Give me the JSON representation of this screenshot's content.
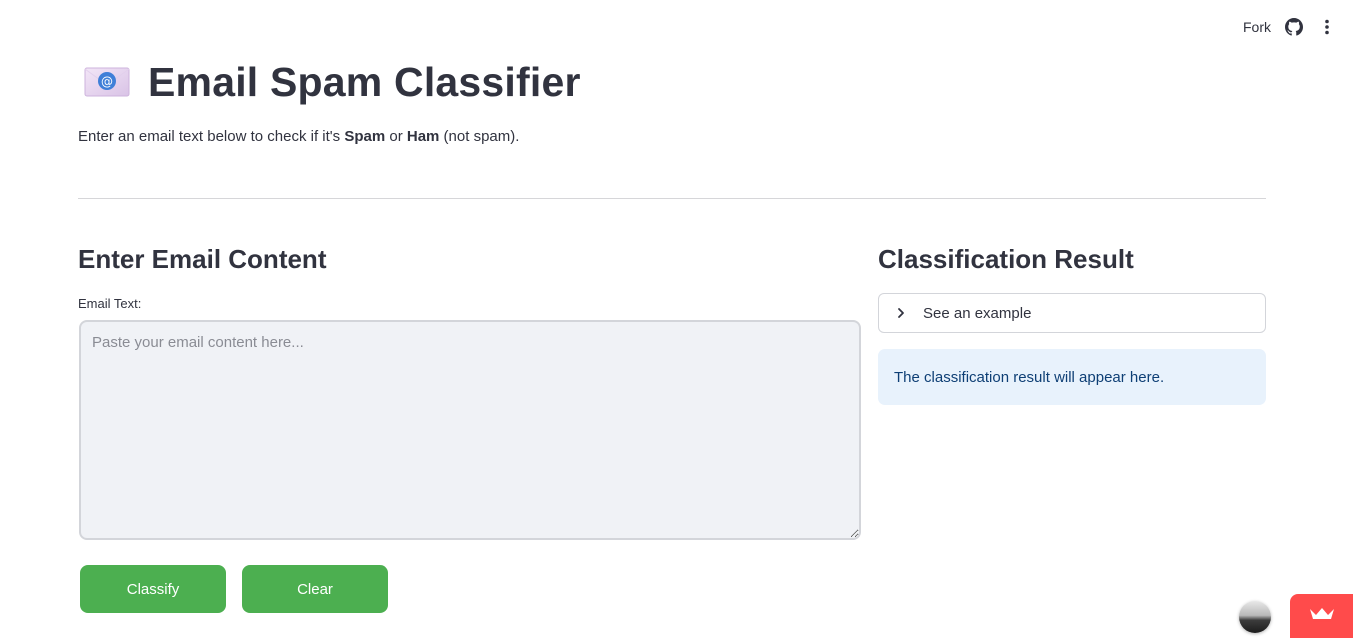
{
  "toolbar": {
    "fork_label": "Fork"
  },
  "header": {
    "title": "Email Spam Classifier",
    "icon": "envelope-email-icon"
  },
  "subtitle": {
    "prefix": "Enter an email text below to check if it's ",
    "spam_word": "Spam",
    "middle": " or ",
    "ham_word": "Ham",
    "suffix": " (not spam)."
  },
  "input_section": {
    "heading": "Enter Email Content",
    "field_label": "Email Text:",
    "value": "",
    "placeholder": "Paste your email content here...",
    "classify_label": "Classify",
    "clear_label": "Clear"
  },
  "result_section": {
    "heading": "Classification Result",
    "expander_label": "See an example",
    "info_message": "The classification result will appear here."
  },
  "colors": {
    "button_green": "#4caf50",
    "info_background": "#e8f2fc",
    "info_text": "#0e3f75",
    "badge_red": "#ff4b4b",
    "text": "#31333f"
  }
}
